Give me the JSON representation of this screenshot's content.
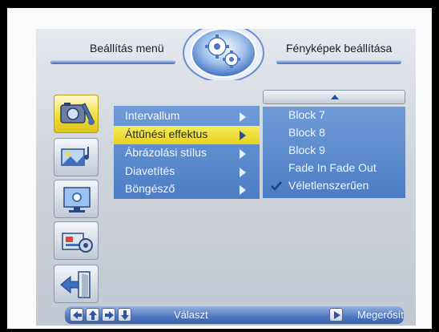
{
  "header": {
    "left_title": "Beállítás menü",
    "right_title": "Fényképek beállítása",
    "emblem_icon": "settings-gears-icon"
  },
  "sidebar": {
    "items": [
      {
        "name": "photo-settings-icon",
        "active": true
      },
      {
        "name": "picture-music-icon",
        "active": false
      },
      {
        "name": "display-monitor-icon",
        "active": false
      },
      {
        "name": "system-settings-icon",
        "active": false
      },
      {
        "name": "exit-door-icon",
        "active": false
      }
    ]
  },
  "menu": {
    "items": [
      {
        "label": "Intervallum"
      },
      {
        "label": "Áttűnési effektus"
      },
      {
        "label": "Ábrázolási stílus"
      },
      {
        "label": "Diavetítés"
      },
      {
        "label": "Böngésző"
      }
    ],
    "selected_index": 1
  },
  "submenu": {
    "scroll_icon": "scroll-up-icon",
    "items": [
      {
        "label": "Block 7"
      },
      {
        "label": "Block 8"
      },
      {
        "label": "Block 9"
      },
      {
        "label": "Fade In Fade Out"
      },
      {
        "label": "Véletlenszerűen"
      }
    ],
    "checked_index": 4
  },
  "footer": {
    "nav_icons": [
      "arrow-left-icon",
      "arrow-up-icon",
      "arrow-right-icon",
      "arrow-down-icon"
    ],
    "select_label": "Választ",
    "confirm_icon": "play-confirm-icon",
    "confirm_label": "Megerősít"
  },
  "colors": {
    "panel_blue": "#5b89cd",
    "highlight_yellow": "#ecd928",
    "header_line_blue": "#6f92d2"
  }
}
